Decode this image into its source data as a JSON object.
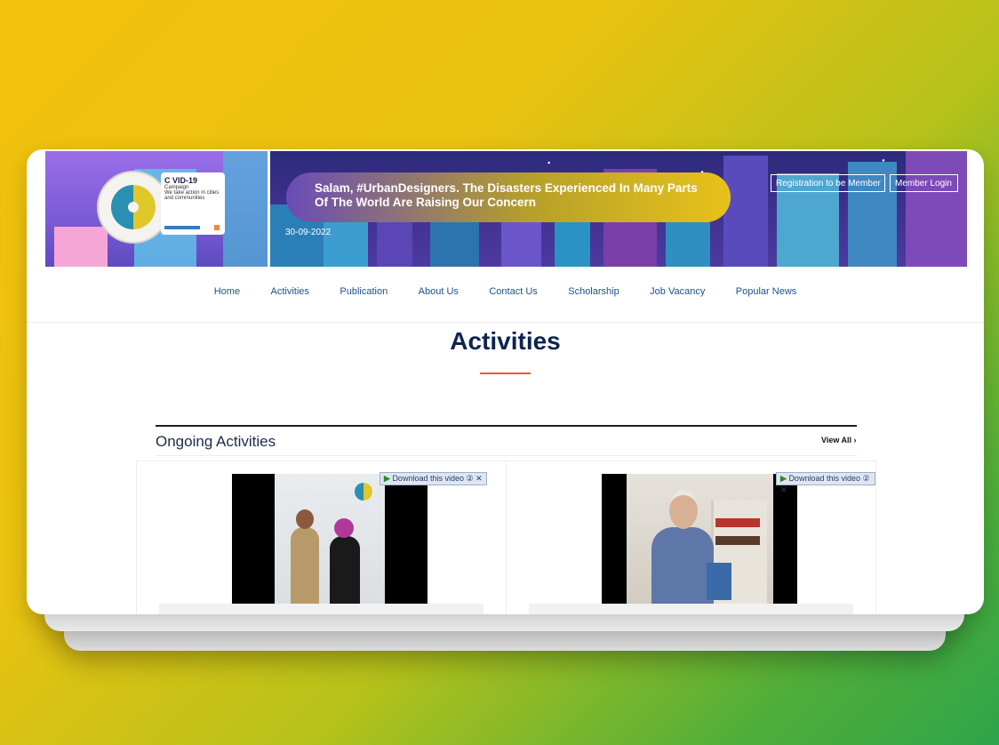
{
  "banner": {
    "announcement": "Salam, #UrbanDesigners. The Disasters Experienced In Many Parts Of The World Are Raising Our Concern",
    "date": "30-09-2022",
    "register_label": "Registration to be Member",
    "login_label": "Member Login",
    "covid_badge": {
      "title": "C VID-19",
      "subtitle": "Campaign",
      "text": "We take action in cities and communities"
    }
  },
  "nav": {
    "items": [
      "Home",
      "Activities",
      "Publication",
      "About Us",
      "Contact Us",
      "Scholarship",
      "Job Vacancy",
      "Popular News"
    ]
  },
  "section": {
    "title": "Activities",
    "ongoing_label": "Ongoing Activities",
    "view_all_label": "View All ›"
  },
  "videos": [
    {
      "download_label": "Download this video",
      "controls": "② ✕"
    },
    {
      "download_label": "Download this video",
      "controls": "② ✕"
    }
  ],
  "colors": {
    "background_start": "#f3c10a",
    "background_end": "#2fa44a",
    "title_color": "#0d2450",
    "nav_color": "#1d4f8c",
    "accent_underline": "#f05a28"
  },
  "icons": {
    "logo": "yin-yang-globe-logo",
    "play": "play-triangle-icon",
    "close": "close-icon",
    "chevron": "chevron-right-icon"
  }
}
